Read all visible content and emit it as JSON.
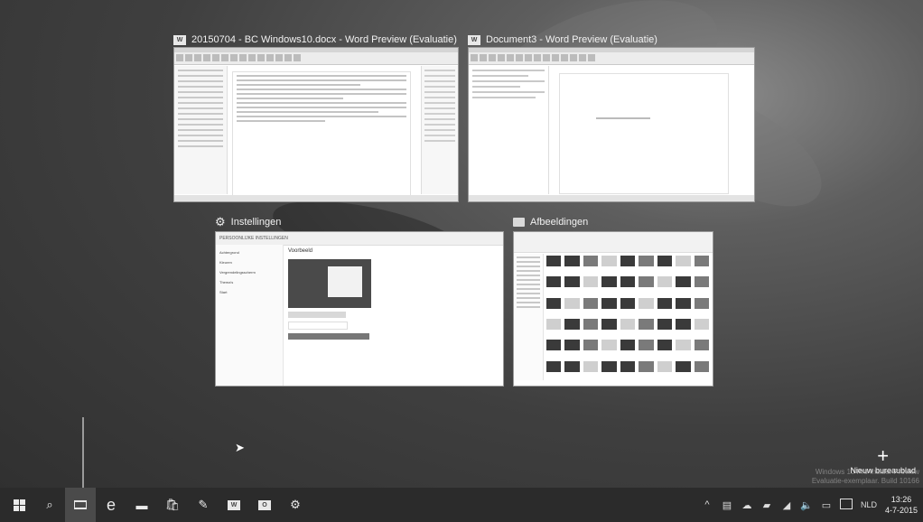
{
  "windows": [
    {
      "title": "20150704 - BC Windows10.docx - Word Preview (Evaluatie)",
      "app_badge": "W"
    },
    {
      "title": "Document3 - Word Preview (Evaluatie)",
      "app_badge": "W"
    },
    {
      "title": "Instellingen",
      "icon": "gear-icon"
    },
    {
      "title": "Afbeeldingen",
      "icon": "folder-icon"
    }
  ],
  "settings_thumb": {
    "header": "PERSOONLIJKE INSTELLINGEN",
    "side_items": [
      "Achtergrond",
      "Kleuren",
      "Vergrendelingsscherm",
      "Thema's",
      "Start"
    ],
    "section": "Voorbeeld"
  },
  "new_desktop": {
    "label": "Nieuw bureaublad"
  },
  "watermark": [
    "Windows 10 Pro Insider Preview",
    "Evaluatie-exemplaar. Build 10166"
  ],
  "taskbar": {
    "buttons": [
      "start-icon",
      "search-icon",
      "task-view-icon",
      "edge-icon",
      "explorer-icon",
      "store-icon",
      "app-icon",
      "word-icon",
      "outlook-icon",
      "settings-icon"
    ],
    "word_badge": "W",
    "outlook_badge": "O"
  },
  "tray": {
    "language": "NLD",
    "time": "13:26",
    "date": "4-7-2015"
  }
}
